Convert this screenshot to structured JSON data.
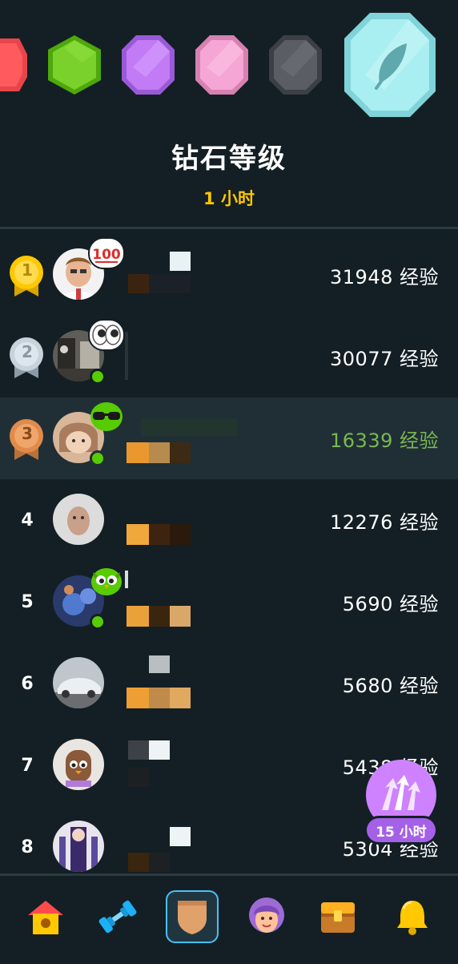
{
  "league": {
    "title": "钻石等级",
    "time_left": "1 小时",
    "badges": [
      "red-badge-icon",
      "green-badge-icon",
      "purple-badge-icon",
      "pink-badge-icon",
      "gray-badge-icon",
      "diamond-badge-icon"
    ]
  },
  "leaderboard": [
    {
      "rank": "1",
      "medal": "gold",
      "xp": "31948 经验",
      "online": false,
      "sticker": "100-emoji-icon"
    },
    {
      "rank": "2",
      "medal": "silver",
      "xp": "30077 经验",
      "online": true,
      "sticker": "eyes-emoji-icon"
    },
    {
      "rank": "3",
      "medal": "bronze",
      "xp": "16339 经验",
      "online": true,
      "sticker": "sunglasses-emoji-icon",
      "is_current_user": true
    },
    {
      "rank": "4",
      "xp": "12276 经验",
      "online": false
    },
    {
      "rank": "5",
      "xp": "5690 经验",
      "online": true,
      "sticker": "duo-owl-icon"
    },
    {
      "rank": "6",
      "xp": "5680 经验",
      "online": false
    },
    {
      "rank": "7",
      "xp": "5438 经验",
      "online": false
    },
    {
      "rank": "8",
      "xp": "5304 经验",
      "online": false
    }
  ],
  "floating_boost": {
    "label": "15 小时",
    "icon": "xp-boost-arrows-icon"
  },
  "tabs": [
    {
      "name": "tab-learn",
      "icon": "home-icon"
    },
    {
      "name": "tab-practice",
      "icon": "dumbbell-icon"
    },
    {
      "name": "tab-leaderboard",
      "icon": "shield-icon",
      "active": true
    },
    {
      "name": "tab-profile",
      "icon": "profile-icon"
    },
    {
      "name": "tab-quests",
      "icon": "chest-icon"
    },
    {
      "name": "tab-notifications",
      "icon": "bell-icon"
    }
  ],
  "colors": {
    "background": "#131f24",
    "accent_gold": "#ffc800",
    "current_user_xp": "#79b851",
    "active_tab": "#49c0f8",
    "boost_purple": "#ce82ff"
  }
}
